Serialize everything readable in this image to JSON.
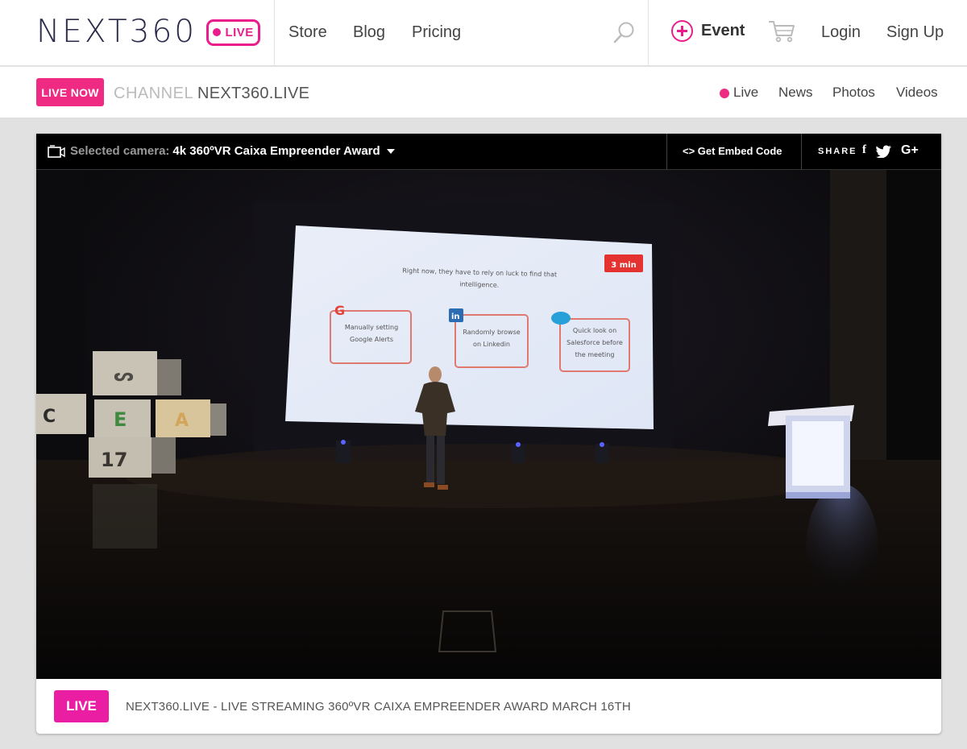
{
  "header": {
    "logo_text": "NEXT360",
    "logo_badge": "LIVE",
    "nav": [
      {
        "label": "Store"
      },
      {
        "label": "Blog"
      },
      {
        "label": "Pricing"
      }
    ],
    "event_label": "Event",
    "login_label": "Login",
    "signup_label": "Sign Up"
  },
  "subbar": {
    "live_now": "LIVE NOW",
    "channel_label": "CHANNEL",
    "channel_name": "NEXT360.LIVE",
    "links": [
      {
        "label": "Live"
      },
      {
        "label": "News"
      },
      {
        "label": "Photos"
      },
      {
        "label": "Videos"
      }
    ]
  },
  "player": {
    "camera_label": "Selected camera:",
    "camera_value": "4k 360ºVR Caixa Empreender Award",
    "embed_label": "<> Get Embed Code",
    "share_label": "SHARE",
    "social": [
      "f",
      "t",
      "G+"
    ],
    "slide": {
      "timer": "3 min",
      "heading": "Right now, they have to rely on luck to find that intelligence.",
      "boxes": [
        {
          "icon": "G",
          "text": "Manually setting Google Alerts"
        },
        {
          "icon": "in",
          "text": "Randomly browse on Linkedin"
        },
        {
          "icon": "salesforce",
          "text": "Quick look on Salesforce before the meeting"
        }
      ]
    },
    "caption_badge": "LIVE",
    "caption_text": "NEXT360.LIVE - LIVE STREAMING 360ºVR CAIXA EMPREENDER AWARD MARCH 16TH"
  },
  "colors": {
    "brand_pink": "#e91e8c",
    "live_now_bg": "#ef2a83",
    "caption_live_bg": "#e91ea3"
  }
}
